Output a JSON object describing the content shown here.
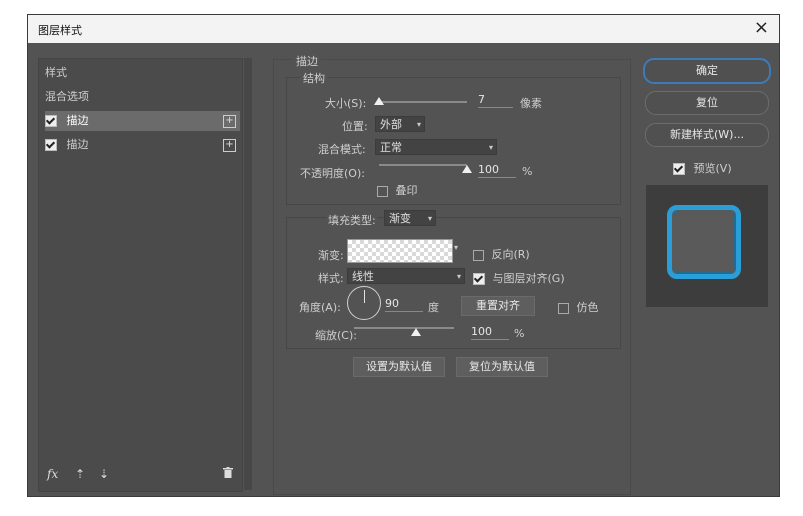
{
  "window": {
    "title": "图层样式",
    "close_glyph": "×"
  },
  "left_panel": {
    "items": [
      {
        "label": "样式"
      },
      {
        "label": "混合选项"
      },
      {
        "label": "描边",
        "checked": true,
        "selected": true
      },
      {
        "label": "描边",
        "checked": true,
        "selected": false
      }
    ],
    "footer": {
      "fx": "fx",
      "up": "⇡",
      "down": "⇣",
      "trash": "🗑"
    }
  },
  "stroke": {
    "section_title": "描边",
    "structure_title": "结构",
    "size_label": "大小(S):",
    "size_value": "7",
    "size_unit": "像素",
    "size_fraction": 0.0,
    "position_label": "位置:",
    "position_value": "外部",
    "blend_label": "混合模式:",
    "blend_value": "正常",
    "opacity_label": "不透明度(O):",
    "opacity_value": "100",
    "opacity_unit": "%",
    "opacity_fraction": 1.0,
    "overprint_label": "叠印"
  },
  "fill": {
    "type_label": "填充类型:",
    "type_value": "渐变",
    "gradient_label": "渐变:",
    "reverse_label": "反向(R)",
    "style_label": "样式:",
    "style_value": "线性",
    "align_label": "与图层对齐(G)",
    "angle_label": "角度(A):",
    "angle_value": "90",
    "angle_unit": "度",
    "reset_align_button": "重置对齐",
    "dither_label": "仿色",
    "scale_label": "缩放(C):",
    "scale_value": "100",
    "scale_unit": "%",
    "scale_fraction": 0.5
  },
  "defaults": {
    "set_default": "设置为默认值",
    "reset_default": "复位为默认值"
  },
  "right": {
    "ok": "确定",
    "reset": "复位",
    "new_style": "新建样式(W)...",
    "preview_label": "预览(V)"
  },
  "colors": {
    "accent": "#2a9ed6",
    "dialog_bg": "#535353"
  }
}
